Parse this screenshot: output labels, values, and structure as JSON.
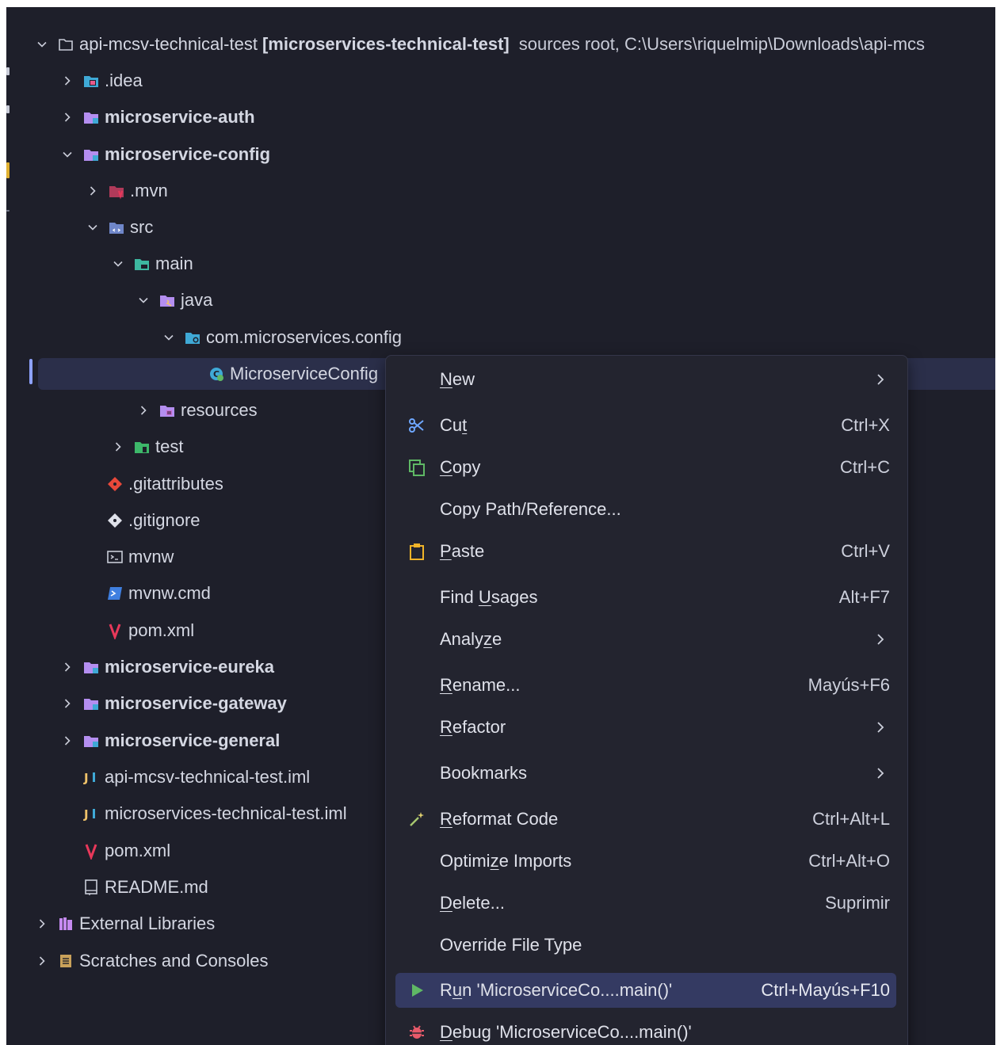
{
  "tree": {
    "root": {
      "label": "api-mcsv-technical-test",
      "bracket": "[microservices-technical-test]",
      "path": "sources root,  C:\\Users\\riquelmip\\Downloads\\api-mcs"
    },
    "idea": ".idea",
    "auth": "microservice-auth",
    "config": "microservice-config",
    "mvn": ".mvn",
    "src": "src",
    "main": "main",
    "java": "java",
    "pkg": "com.microservices.config",
    "cls": "MicroserviceConfig",
    "resources": "resources",
    "test": "test",
    "gitattributes": ".gitattributes",
    "gitignore": ".gitignore",
    "mvnw": "mvnw",
    "mvnwcmd": "mvnw.cmd",
    "pom_inner": "pom.xml",
    "eureka": "microservice-eureka",
    "gateway": "microservice-gateway",
    "general": "microservice-general",
    "iml1": "api-mcsv-technical-test.iml",
    "iml2": "microservices-technical-test.iml",
    "pom": "pom.xml",
    "readme": "README.md",
    "extlibs": "External Libraries",
    "scratches": "Scratches and Consoles"
  },
  "menu": {
    "new": {
      "pre": "",
      "u": "N",
      "post": "ew"
    },
    "cut": {
      "pre": "Cu",
      "u": "t",
      "post": "",
      "shortcut": "Ctrl+X"
    },
    "copy": {
      "pre": "",
      "u": "C",
      "post": "opy",
      "shortcut": "Ctrl+C"
    },
    "copy_path": "Copy Path/Reference...",
    "paste": {
      "pre": "",
      "u": "P",
      "post": "aste",
      "shortcut": "Ctrl+V"
    },
    "find": {
      "pre": "Find ",
      "u": "U",
      "post": "sages",
      "shortcut": "Alt+F7"
    },
    "analyze": {
      "pre": "Analy",
      "u": "z",
      "post": "e"
    },
    "rename": {
      "pre": "",
      "u": "R",
      "post": "ename...",
      "shortcut": "Mayús+F6"
    },
    "refactor": {
      "pre": "",
      "u": "R",
      "post": "efactor"
    },
    "bookmarks": "Bookmarks",
    "reformat": {
      "pre": "",
      "u": "R",
      "post": "eformat Code",
      "shortcut": "Ctrl+Alt+L"
    },
    "optimize": {
      "pre": "Optimi",
      "u": "z",
      "post": "e Imports",
      "shortcut": "Ctrl+Alt+O"
    },
    "delete": {
      "pre": "",
      "u": "D",
      "post": "elete...",
      "shortcut": "Suprimir"
    },
    "override": "Override File Type",
    "run": {
      "pre": "R",
      "u": "u",
      "post": "n 'MicroserviceCo....main()'",
      "shortcut": "Ctrl+Mayús+F10"
    },
    "debug": {
      "pre": "",
      "u": "D",
      "post": "ebug 'MicroserviceCo....main()'"
    }
  },
  "colors": {
    "background": "#1e1f2a",
    "menu_background": "#23242f",
    "highlight": "#343a62",
    "selection": "#2b2f4a",
    "module_folder": "#b48ef0",
    "run_green": "#5fb865",
    "maven_red": "#e8385a"
  }
}
